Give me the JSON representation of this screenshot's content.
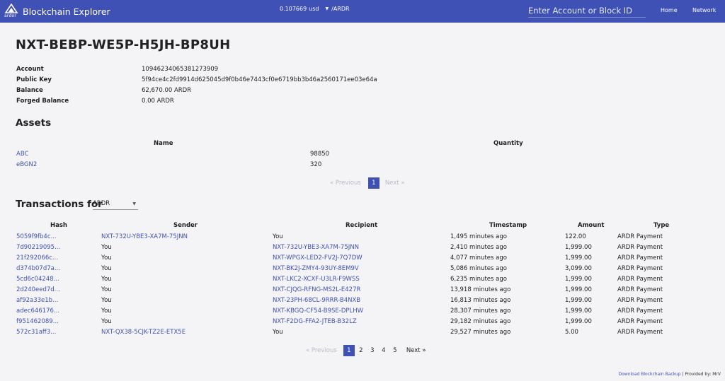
{
  "header": {
    "brand_title": "Blockchain Explorer",
    "logo_text": "ardor",
    "price": "0.107669",
    "currency": "usd",
    "pair": "/ARDR",
    "search_placeholder": "Enter Account or Block ID",
    "nav": {
      "home": "Home",
      "network": "Network"
    },
    "colors": {
      "navbar": "#3f51b5"
    }
  },
  "account": {
    "title": "NXT-BEBP-WE5P-H5JH-BP8UH",
    "rows": [
      {
        "label": "Account",
        "value": "10946234065381273909"
      },
      {
        "label": "Public Key",
        "value": "5f94ce4c2fd9914d625045d9f0b46e7443cf0e6719bb3b46a2560171ee03e64a"
      },
      {
        "label": "Balance",
        "value": "62,670.00 ARDR"
      },
      {
        "label": "Forged Balance",
        "value": "0.00 ARDR"
      }
    ]
  },
  "assets": {
    "heading": "Assets",
    "columns": [
      "Name",
      "Quantity"
    ],
    "rows": [
      {
        "name": "ABC",
        "quantity": "98850"
      },
      {
        "name": "eBGN2",
        "quantity": "320"
      }
    ],
    "pager": {
      "prev": "« Previous",
      "pages": [
        "1"
      ],
      "next": "Next »"
    }
  },
  "transactions": {
    "heading": "Transactions for",
    "chain": "ARDR",
    "columns": [
      "Hash",
      "Sender",
      "Recipient",
      "Timestamp",
      "Amount",
      "Type"
    ],
    "rows": [
      {
        "hash": "5059f9fb4c...",
        "sender": "NXT-732U-YBE3-XA7M-75JNN",
        "recipient": "You",
        "timestamp": "1,495 minutes ago",
        "amount": "122.00",
        "type": "ARDR Payment"
      },
      {
        "hash": "7d90219095...",
        "sender": "You",
        "recipient": "NXT-732U-YBE3-XA7M-75JNN",
        "timestamp": "2,410 minutes ago",
        "amount": "1,999.00",
        "type": "ARDR Payment"
      },
      {
        "hash": "21f292066c...",
        "sender": "You",
        "recipient": "NXT-WPGX-LED2-FV2J-7Q7DW",
        "timestamp": "4,077 minutes ago",
        "amount": "1,999.00",
        "type": "ARDR Payment"
      },
      {
        "hash": "d374b07d7a...",
        "sender": "You",
        "recipient": "NXT-BK2J-ZMY4-93UY-8EM9V",
        "timestamp": "5,086 minutes ago",
        "amount": "3,099.00",
        "type": "ARDR Payment"
      },
      {
        "hash": "5cd6c04248...",
        "sender": "You",
        "recipient": "NXT-LKC2-XCXF-U3LR-F9WSS",
        "timestamp": "6,235 minutes ago",
        "amount": "1,999.00",
        "type": "ARDR Payment"
      },
      {
        "hash": "2d240eed7d...",
        "sender": "You",
        "recipient": "NXT-CJQG-RFNG-MS2L-E427R",
        "timestamp": "13,918 minutes ago",
        "amount": "1,999.00",
        "type": "ARDR Payment"
      },
      {
        "hash": "af92a33e1b...",
        "sender": "You",
        "recipient": "NXT-23PH-68CL-9RRR-B4NXB",
        "timestamp": "16,813 minutes ago",
        "amount": "1,999.00",
        "type": "ARDR Payment"
      },
      {
        "hash": "adec646176...",
        "sender": "You",
        "recipient": "NXT-KBGQ-CF54-B9SE-DPLHW",
        "timestamp": "28,307 minutes ago",
        "amount": "1,999.00",
        "type": "ARDR Payment"
      },
      {
        "hash": "f951462089...",
        "sender": "You",
        "recipient": "NXT-F2DG-FFA2-JTEB-B32LZ",
        "timestamp": "29,182 minutes ago",
        "amount": "1,999.00",
        "type": "ARDR Payment"
      },
      {
        "hash": "572c31aff3...",
        "sender": "NXT-QX38-5CJK-TZ2E-ETX5E",
        "recipient": "You",
        "timestamp": "29,527 minutes ago",
        "amount": "5.00",
        "type": "ARDR Payment"
      }
    ],
    "pager": {
      "prev": "« Previous",
      "pages": [
        "1",
        "2",
        "3",
        "4",
        "5"
      ],
      "next": "Next »"
    }
  },
  "footer": {
    "download": "Download Blockchain Backup",
    "separator": " | Provided by: ",
    "provider": "MrV"
  }
}
